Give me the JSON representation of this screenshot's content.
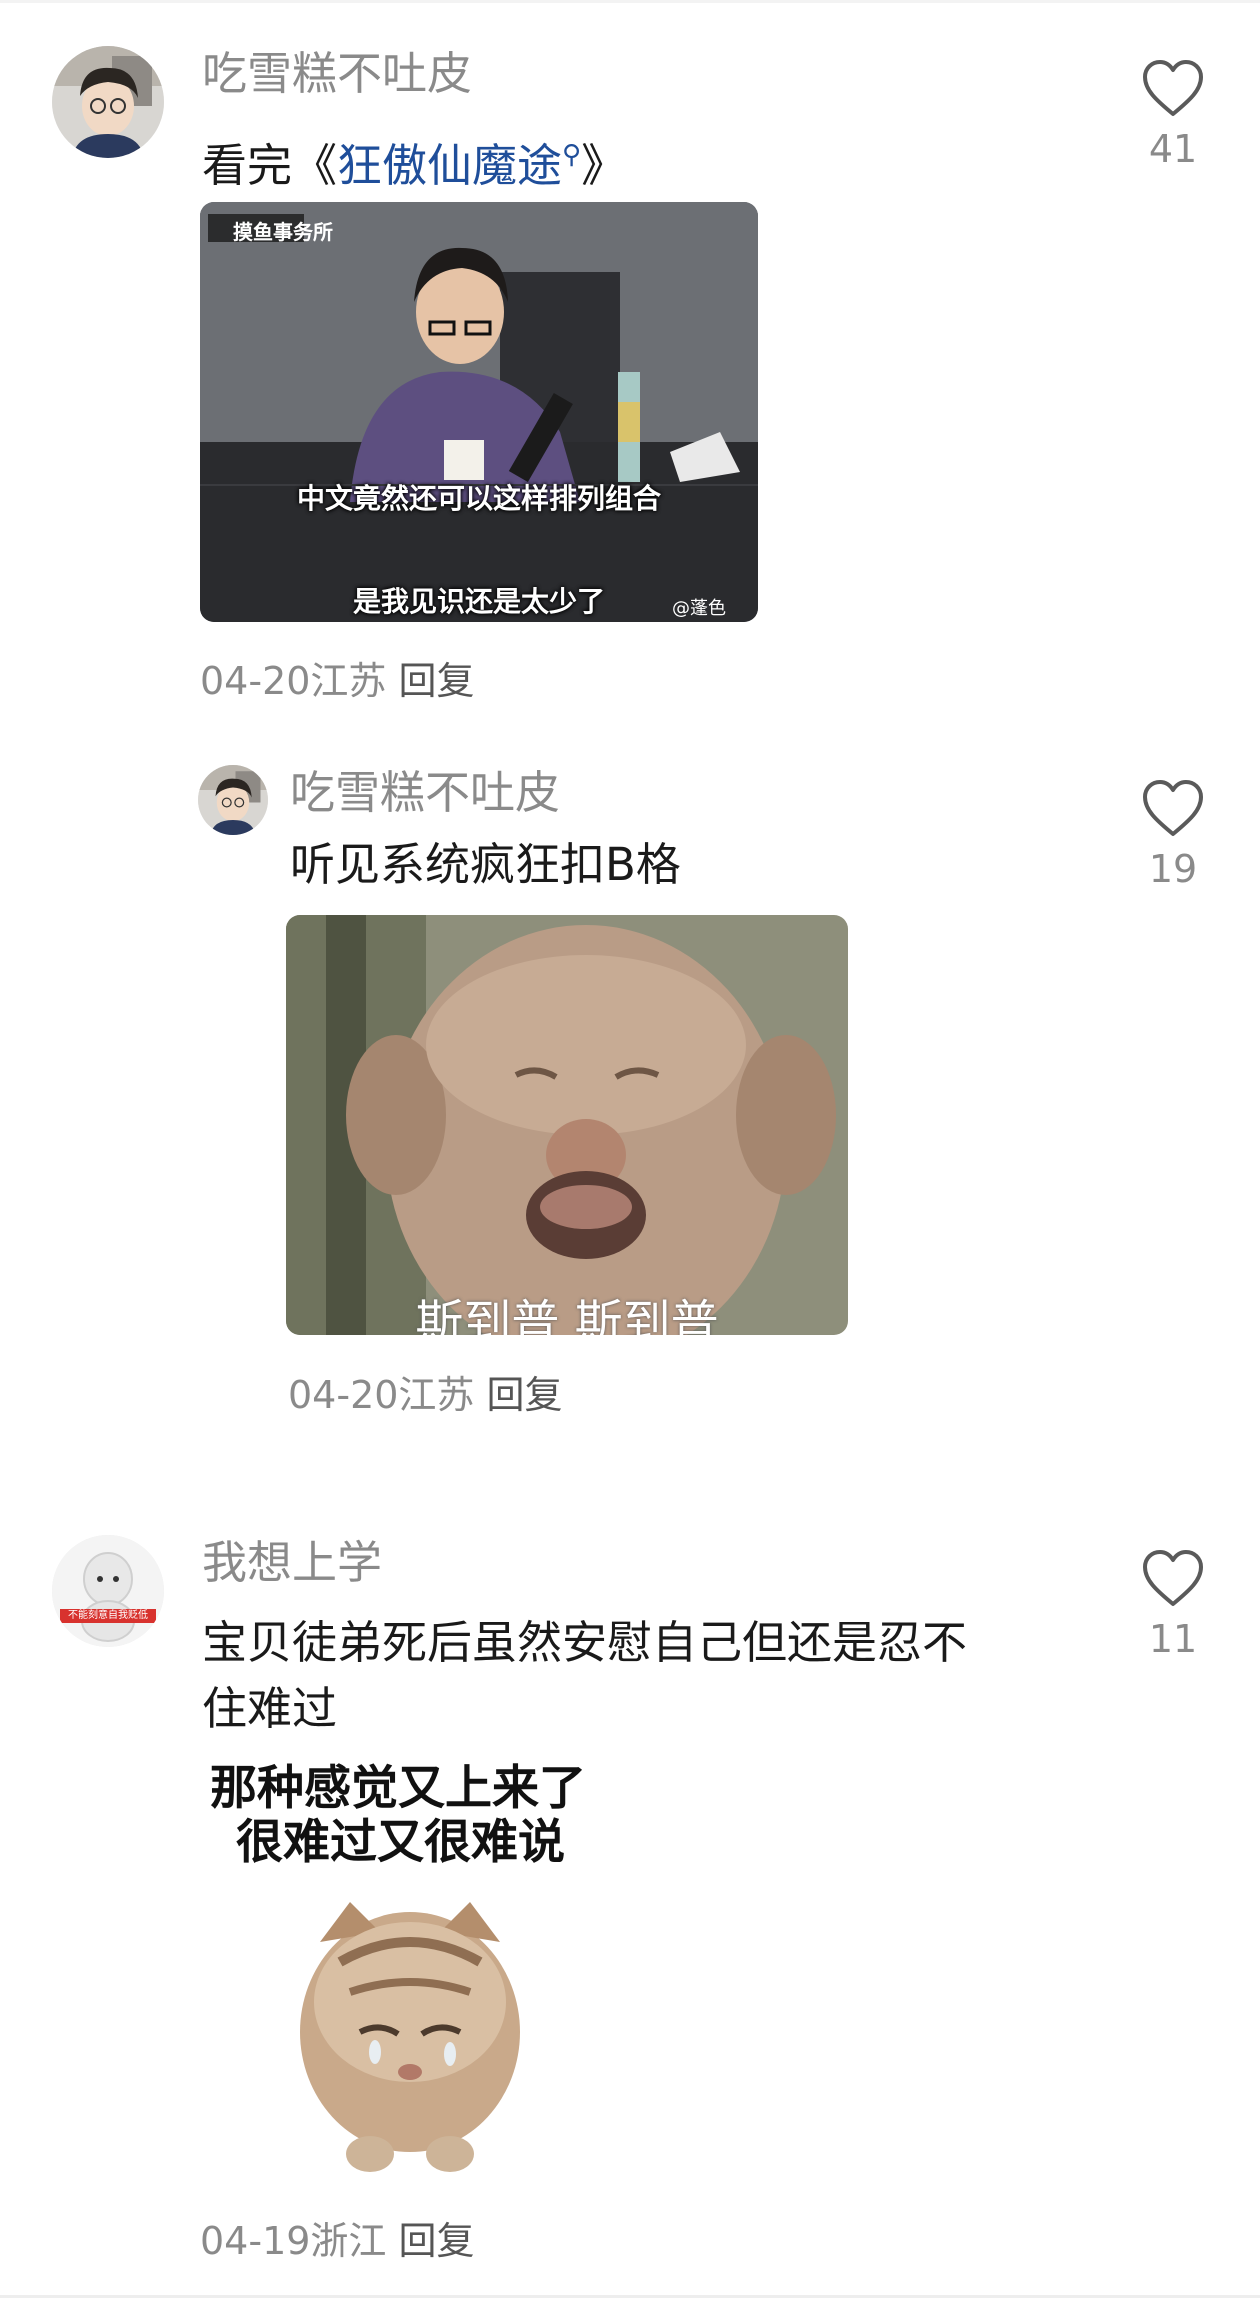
{
  "comments": [
    {
      "username": "吃雪糕不吐皮",
      "text_prefix": "看完《",
      "link_text": "狂傲仙魔途",
      "text_suffix": "》",
      "image_captions": [
        "摸鱼事务所",
        "中文竟然还可以这样排列组合",
        "是我见识还是太少了",
        "@蓬色"
      ],
      "date": "04-20",
      "location": "江苏",
      "reply": "回复",
      "likes": "41"
    },
    {
      "username": "吃雪糕不吐皮",
      "text": "听见系统疯狂扣B格",
      "image_caption": "斯到普 斯到普",
      "date": "04-20",
      "location": "江苏",
      "reply": "回复",
      "likes": "19"
    },
    {
      "username": "我想上学",
      "avatar_caption": "不能刻意自我贬低",
      "text_line1": "宝贝徒弟死后虽然安慰自己但还是忍不",
      "text_line2": "住难过",
      "sticker_line1": "那种感觉又上来了",
      "sticker_line2": "很难过又很难说",
      "date": "04-19",
      "location": "浙江",
      "reply": "回复",
      "likes": "11"
    }
  ],
  "colors": {
    "username": "#8a8a8a",
    "link": "#1f4e9a",
    "meta": "#8a8a8a"
  }
}
